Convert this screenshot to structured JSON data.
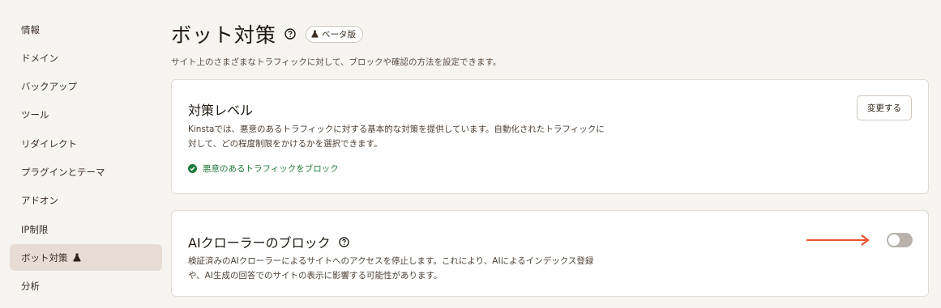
{
  "sidebar": {
    "items": [
      {
        "label": "情報"
      },
      {
        "label": "ドメイン"
      },
      {
        "label": "バックアップ"
      },
      {
        "label": "ツール"
      },
      {
        "label": "リダイレクト"
      },
      {
        "label": "プラグインとテーマ"
      },
      {
        "label": "アドオン"
      },
      {
        "label": "IP制限"
      },
      {
        "label": "ボット対策",
        "active": true,
        "icon": "flask-icon"
      },
      {
        "label": "分析"
      }
    ]
  },
  "header": {
    "title": "ボット対策",
    "badge": "ベータ版",
    "subtitle": "サイト上のさまざまなトラフィックに対して、ブロックや確認の方法を設定できます。"
  },
  "protection_level": {
    "title": "対策レベル",
    "description": "Kinstaでは、悪意のあるトラフィックに対する基本的な対策を提供しています。自動化されたトラフィックに対して、どの程度制限をかけるかを選択できます。",
    "status": "悪意のあるトラフィックをブロック",
    "change_label": "変更する"
  },
  "ai_crawler": {
    "title": "AIクローラーのブロック",
    "description": "検証済みのAIクローラーによるサイトへのアクセスを停止します。これにより、AIによるインデックス登録や、AI生成の回答でのサイトの表示に影響する可能性があります。",
    "enabled": false
  },
  "colors": {
    "accent_arrow": "#f0522a",
    "status_green": "#1e7a3c",
    "active_nav": "#e6dcd3"
  }
}
